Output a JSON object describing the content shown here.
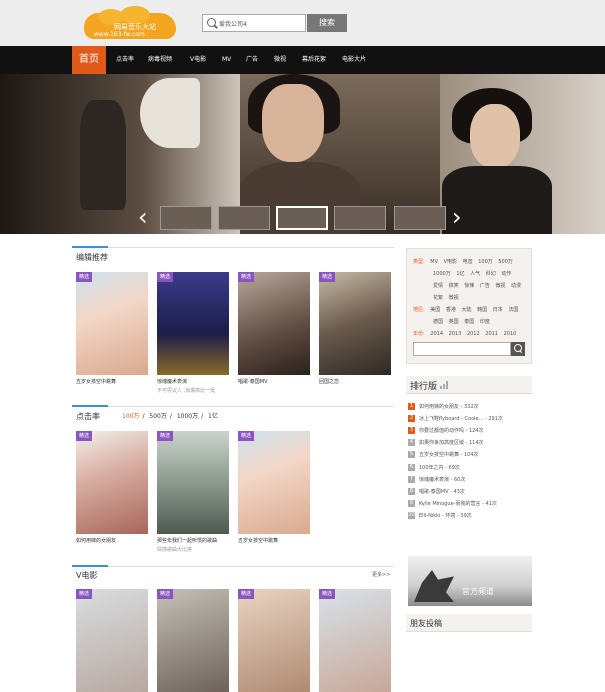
{
  "header": {
    "logo_title": "网易音乐大站",
    "logo_url": "www.163-fw.com",
    "search_value": "爱我公司4",
    "search_button": "搜索"
  },
  "nav": {
    "home": "首页",
    "items": [
      "点击率",
      "病毒视频",
      "V电影",
      "MV",
      "广告",
      "微视",
      "幕后花絮",
      "电影大片"
    ]
  },
  "sections": {
    "recommend": {
      "title": "编辑推荐",
      "cards": [
        {
          "caption": "五岁女孩空中跳舞",
          "sub": ""
        },
        {
          "caption": "惊魂魔术表演",
          "sub": "不可思议入 ,惊爆高比一挺"
        },
        {
          "caption": "唱歌-泰国MV",
          "sub": ""
        },
        {
          "caption": "回国之恋",
          "sub": ""
        }
      ]
    },
    "clicks": {
      "title": "点击率",
      "tabs": [
        "100万",
        "500万",
        "1000万",
        "1亿"
      ],
      "separator": "/",
      "cards": [
        {
          "caption": "如何用嫁的女朋友",
          "sub": ""
        },
        {
          "caption": "那些年我们一起听惯的歌曲",
          "sub": "情感歌曲大比拼"
        },
        {
          "caption": "五岁女孩空中跳舞",
          "sub": ""
        }
      ]
    },
    "vmovie": {
      "title": "V电影",
      "more": "更多>>"
    }
  },
  "card_tag": "精选",
  "sidebar": {
    "filter": {
      "type_label": "类型:",
      "type_items_1": [
        "MV",
        "V电影",
        "电音",
        "100万",
        "500万"
      ],
      "type_items_2": [
        "1000万",
        "1亿",
        "人气",
        "科幻",
        "动作"
      ],
      "type_items_3": [
        "爱情",
        "搞笑",
        "惊悚",
        "广告",
        "微视",
        "动漫"
      ],
      "type_items_4": [
        "花絮",
        "微视"
      ],
      "region_label": "地区:",
      "region_items_1": [
        "美国",
        "香港",
        "大陆",
        "韩国",
        "日本",
        "法国"
      ],
      "region_items_2": [
        "德国",
        "英国",
        "泰国",
        "印度"
      ],
      "year_label": "年份:",
      "year_items": [
        "2014",
        "2013",
        "2012",
        "2011",
        "2010"
      ]
    },
    "rank_title": "排行版",
    "rank": [
      {
        "num": "1",
        "text": "如何用嫁的女朋友 - 332次"
      },
      {
        "num": "2",
        "text": "冰上飞鞋flyboard - Coole... - 291次"
      },
      {
        "num": "3",
        "text": "你要过都值的动作吗 - 124次"
      },
      {
        "num": "4",
        "text": "如果你争加高度区域 - 114次"
      },
      {
        "num": "5",
        "text": "五岁女孩空中跳舞 - 104次"
      },
      {
        "num": "6",
        "text": "100年之内 - 69次"
      },
      {
        "num": "7",
        "text": "惊魂魔术表演 - 60次"
      },
      {
        "num": "8",
        "text": "唱歌-泰国MV - 43次"
      },
      {
        "num": "9",
        "text": "Kylie Minogue-而我的营言 - 41次"
      },
      {
        "num": "10",
        "text": "Elli-Nikki - 环境 - 39次"
      }
    ],
    "ad_text": "官方频道",
    "friends_title": "朋友投稿"
  },
  "colors": {
    "accent": "#e05a1a",
    "nav_bg": "#111111",
    "tag": "#8a55c0"
  }
}
